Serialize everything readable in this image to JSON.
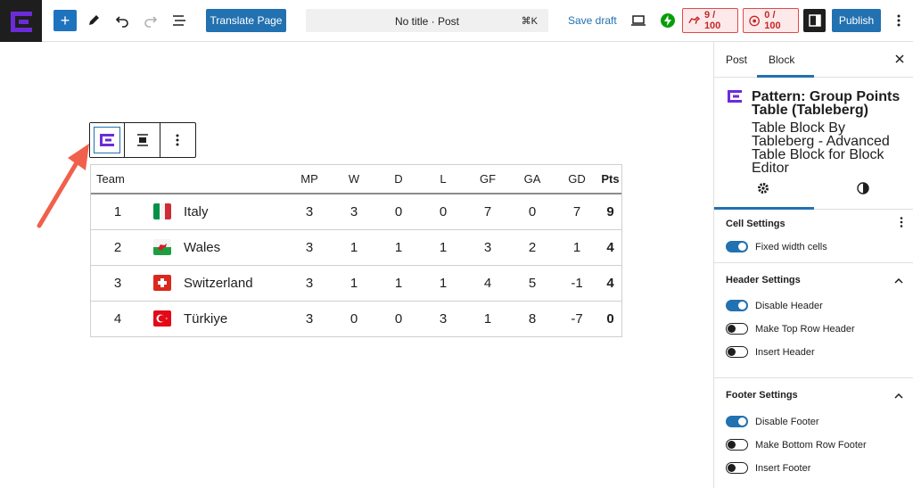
{
  "topbar": {
    "translate_label": "Translate Page",
    "doc_title": "No title · Post",
    "shortcut": "⌘K",
    "save_draft": "Save draft",
    "seo_score": "9 / 100",
    "readability_score": "0 / 100",
    "publish": "Publish"
  },
  "table": {
    "headers": [
      "Team",
      "MP",
      "W",
      "D",
      "L",
      "GF",
      "GA",
      "GD",
      "Pts"
    ],
    "rows": [
      {
        "rank": "1",
        "team": "Italy",
        "flag": "italy-flag-icon",
        "mp": "3",
        "w": "3",
        "d": "0",
        "l": "0",
        "gf": "7",
        "ga": "0",
        "gd": "7",
        "pts": "9"
      },
      {
        "rank": "2",
        "team": "Wales",
        "flag": "wales-flag-icon",
        "mp": "3",
        "w": "1",
        "d": "1",
        "l": "1",
        "gf": "3",
        "ga": "2",
        "gd": "1",
        "pts": "4"
      },
      {
        "rank": "3",
        "team": "Switzerland",
        "flag": "switzerland-flag-icon",
        "mp": "3",
        "w": "1",
        "d": "1",
        "l": "1",
        "gf": "4",
        "ga": "5",
        "gd": "-1",
        "pts": "4"
      },
      {
        "rank": "4",
        "team": "Türkiye",
        "flag": "turkiye-flag-icon",
        "mp": "3",
        "w": "0",
        "d": "0",
        "l": "3",
        "gf": "1",
        "ga": "8",
        "gd": "-7",
        "pts": "0"
      }
    ]
  },
  "sidebar": {
    "tab_post": "Post",
    "tab_block": "Block",
    "block_title": "Pattern: Group Points Table (Tableberg)",
    "block_desc": "Table Block By Tableberg - Advanced Table Block for Block Editor",
    "cell_settings": {
      "title": "Cell Settings",
      "toggles": [
        {
          "label": "Fixed width cells",
          "on": true
        }
      ]
    },
    "header_settings": {
      "title": "Header Settings",
      "toggles": [
        {
          "label": "Disable Header",
          "on": true
        },
        {
          "label": "Make Top Row Header",
          "on": false
        },
        {
          "label": "Insert Header",
          "on": false
        }
      ]
    },
    "footer_settings": {
      "title": "Footer Settings",
      "toggles": [
        {
          "label": "Disable Footer",
          "on": true
        },
        {
          "label": "Make Bottom Row Footer",
          "on": false
        },
        {
          "label": "Insert Footer",
          "on": false
        }
      ]
    }
  },
  "colors": {
    "accent": "#2271b1",
    "brand": "#6c2bd9",
    "dark": "#1e1e1e",
    "score_red": "#e04a4a"
  }
}
